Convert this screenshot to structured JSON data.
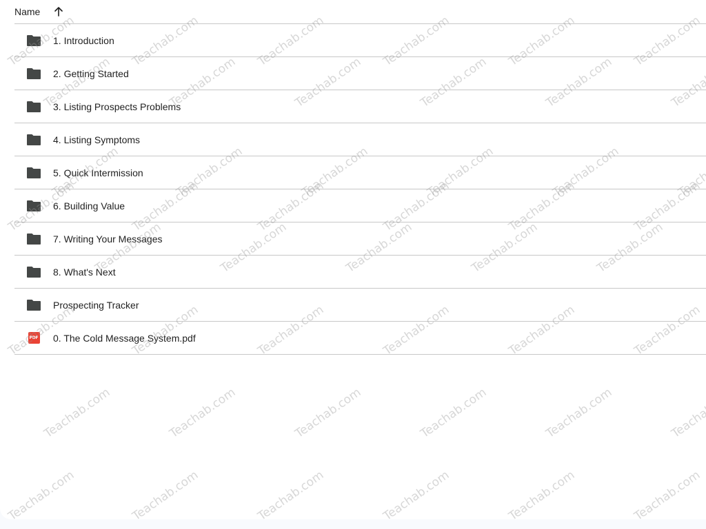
{
  "header": {
    "name_label": "Name",
    "sort_icon": "arrow-up-icon"
  },
  "items": [
    {
      "type": "folder",
      "icon": "folder-icon",
      "label": "1. Introduction"
    },
    {
      "type": "folder",
      "icon": "folder-icon",
      "label": "2. Getting Started"
    },
    {
      "type": "folder",
      "icon": "folder-icon",
      "label": "3. Listing Prospects Problems"
    },
    {
      "type": "folder",
      "icon": "folder-icon",
      "label": "4. Listing Symptoms"
    },
    {
      "type": "folder",
      "icon": "folder-icon",
      "label": "5. Quick Intermission"
    },
    {
      "type": "folder",
      "icon": "folder-icon",
      "label": "6. Building Value"
    },
    {
      "type": "folder",
      "icon": "folder-icon",
      "label": "7. Writing Your Messages"
    },
    {
      "type": "folder",
      "icon": "folder-icon",
      "label": "8. What's Next"
    },
    {
      "type": "folder",
      "icon": "folder-icon",
      "label": "Prospecting Tracker"
    },
    {
      "type": "pdf",
      "icon": "pdf-icon",
      "badge": "PDF",
      "label": "0. The Cold Message System.pdf"
    }
  ],
  "watermark_text": "Teachab.com",
  "colors": {
    "folder": "#444746",
    "pdf": "#ea4335",
    "divider": "#c7c7c7",
    "text": "#1f1f1f"
  }
}
